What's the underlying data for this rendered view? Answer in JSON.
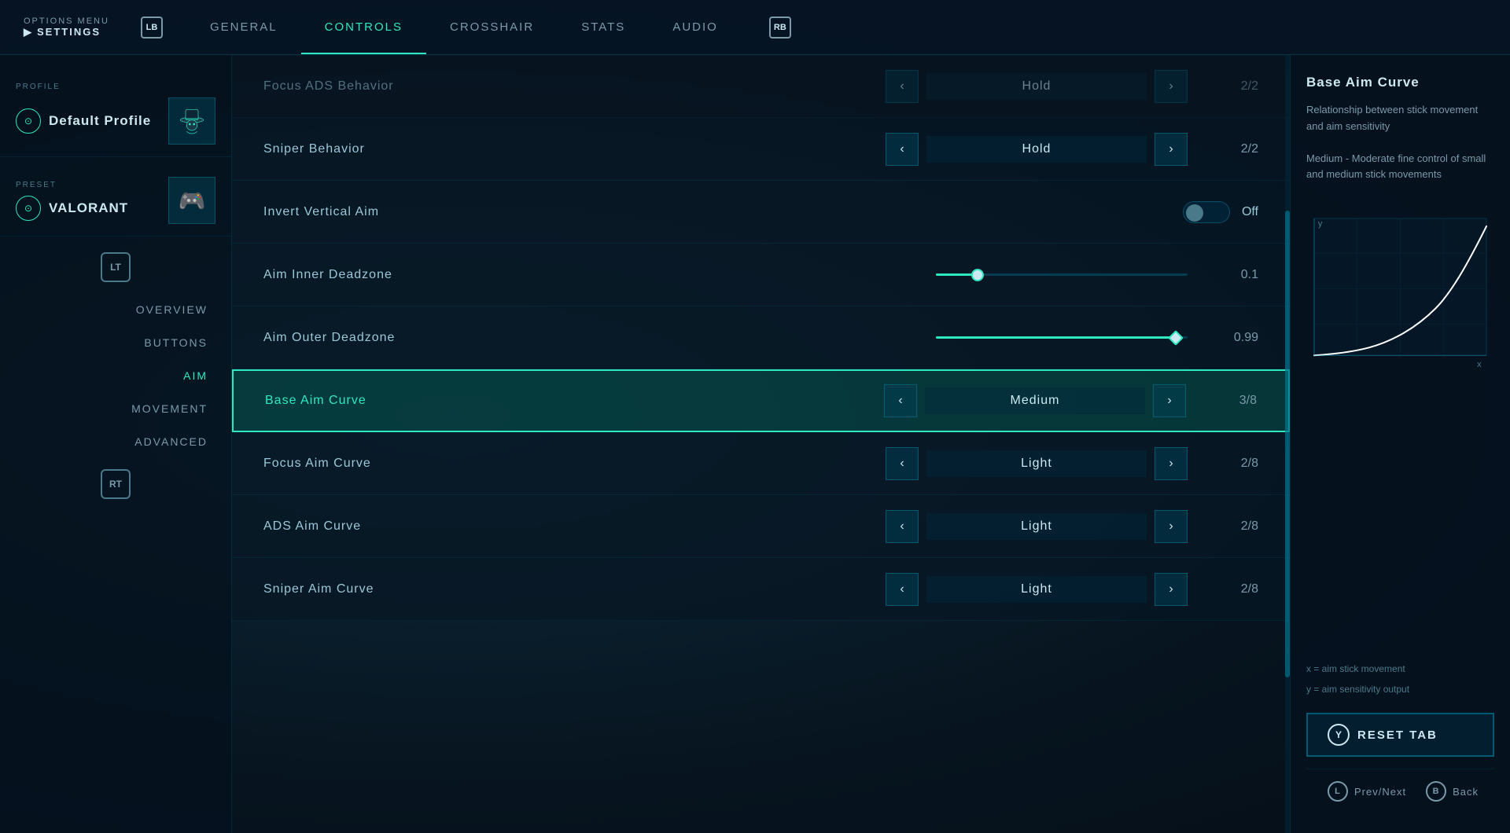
{
  "topNav": {
    "optionsLabel": "OPTIONS MENU",
    "settingsLabel": "SETTINGS",
    "lbBadge": "LB",
    "rbBadge": "RB",
    "tabs": [
      {
        "id": "general",
        "label": "GENERAL",
        "active": false
      },
      {
        "id": "controls",
        "label": "CONTROLS",
        "active": true
      },
      {
        "id": "crosshair",
        "label": "CROSSHAIR",
        "active": false
      },
      {
        "id": "stats",
        "label": "STATS",
        "active": false
      },
      {
        "id": "audio",
        "label": "AUDIO",
        "active": false
      }
    ]
  },
  "sidebar": {
    "profileSection": {
      "label": "PROFILE",
      "name": "Default Profile"
    },
    "presetSection": {
      "label": "PRESET",
      "name": "VALORANT"
    },
    "ltBadge": "LT",
    "navItems": [
      {
        "id": "overview",
        "label": "OVERVIEW",
        "active": false
      },
      {
        "id": "buttons",
        "label": "BUTTONS",
        "active": false
      },
      {
        "id": "aim",
        "label": "AIM",
        "active": true
      },
      {
        "id": "movement",
        "label": "MOVEMENT",
        "active": false
      },
      {
        "id": "advanced",
        "label": "ADVANCED",
        "active": false
      }
    ],
    "rtBadge": "RT"
  },
  "settings": {
    "partialRow": {
      "label": "Focus ADS Behavior",
      "value": "Hold",
      "count": "2/2"
    },
    "rows": [
      {
        "id": "sniper-behavior",
        "label": "Sniper Behavior",
        "type": "select",
        "value": "Hold",
        "count": "2/2",
        "active": false
      },
      {
        "id": "invert-vertical-aim",
        "label": "Invert Vertical Aim",
        "type": "toggle",
        "value": "Off",
        "active": false
      },
      {
        "id": "aim-inner-deadzone",
        "label": "Aim Inner Deadzone",
        "type": "slider",
        "value": "0.1",
        "sliderPercent": 15,
        "diamond": false,
        "active": false
      },
      {
        "id": "aim-outer-deadzone",
        "label": "Aim Outer Deadzone",
        "type": "slider",
        "value": "0.99",
        "sliderPercent": 95,
        "diamond": true,
        "active": false
      },
      {
        "id": "base-aim-curve",
        "label": "Base Aim Curve",
        "type": "select",
        "value": "Medium",
        "count": "3/8",
        "active": true
      },
      {
        "id": "focus-aim-curve",
        "label": "Focus Aim Curve",
        "type": "select",
        "value": "Light",
        "count": "2/8",
        "active": false
      },
      {
        "id": "ads-aim-curve",
        "label": "ADS Aim Curve",
        "type": "select",
        "value": "Light",
        "count": "2/8",
        "active": false
      },
      {
        "id": "sniper-aim-curve",
        "label": "Sniper Aim Curve",
        "type": "select",
        "value": "Light",
        "count": "2/8",
        "active": false
      }
    ]
  },
  "rightPanel": {
    "title": "Base Aim Curve",
    "description": "Relationship between stick movement and aim sensitivity",
    "description2": "Medium - Moderate fine control of small and medium stick movements",
    "chartYLabel": "y",
    "chartXLabel": "x",
    "axisDesc1": "x = aim stick movement",
    "axisDesc2": "y = aim sensitivity output",
    "resetBtn": {
      "badge": "Y",
      "label": "RESET TAB"
    },
    "bottomControls": [
      {
        "badge": "L",
        "label": "Prev/Next"
      },
      {
        "badge": "B",
        "label": "Back"
      }
    ]
  }
}
